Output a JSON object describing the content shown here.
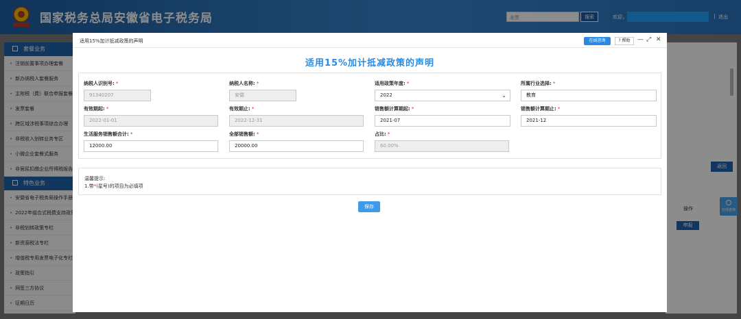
{
  "header": {
    "title": "国家税务总局安徽省电子税务局",
    "search_placeholder": "发票",
    "search_button": "搜索",
    "welcome": "欢迎，",
    "separator": "|",
    "logout": "退出"
  },
  "sidebar": {
    "section1": "套餐业务",
    "items1": [
      "注销前置事项办理套餐",
      "新办纳税人套餐服务",
      "主附税（费）联合申报套餐",
      "发票套餐",
      "跨区域涉税事项综合办理",
      "非税收入划转业务专区",
      "小微企业套餐式服务",
      "非居民扣缴企业所得税报告"
    ],
    "section2": "特色业务",
    "items2": [
      "安徽省电子税务局操作手册",
      "2022年组合式税费支持政策",
      "非税划转政策专栏",
      "新资源税法专栏",
      "增值税专用发票电子化专栏",
      "政策指引",
      "网签三方协议",
      "征期日历"
    ]
  },
  "background": {
    "back_button": "返回",
    "operation_header": "操作",
    "declare_button": "申报",
    "consult_label": "在线咨询"
  },
  "dialog": {
    "title": "适用15%加计抵减政策的声明",
    "online_consult": "在线咨询",
    "help": "? 帮助",
    "minimize": "—",
    "maximize": "⤢",
    "close": "✕",
    "heading": "适用15%加计抵减政策的声明",
    "fields": {
      "taxpayer_id": {
        "label": "纳税人识别号:",
        "value": "91340207"
      },
      "taxpayer_name": {
        "label": "纳税人名称:",
        "value": "安徽"
      },
      "policy_year": {
        "label": "适用政策年度:",
        "value": "2022"
      },
      "industry": {
        "label": "所属行业选择:",
        "value": "教育"
      },
      "valid_from": {
        "label": "有效期起:",
        "value": "2022-01-01"
      },
      "valid_to": {
        "label": "有效期止:",
        "value": "2022-12-31"
      },
      "sales_from": {
        "label": "销售额计算期起:",
        "value": "2021-07"
      },
      "sales_to": {
        "label": "销售额计算期止:",
        "value": "2021-12"
      },
      "life_service_sales": {
        "label": "生活服务销售额合计:",
        "value": "12000.00"
      },
      "total_sales": {
        "label": "全部销售额:",
        "value": "20000.00"
      },
      "ratio": {
        "label": "占比:",
        "value": "60.00%"
      }
    },
    "required_mark": "*",
    "tips_title": "温馨提示:",
    "tips_text_prefix": "1.带",
    "tips_text_suffix": "(星号)的项目为必填项",
    "save_button": "保存"
  }
}
